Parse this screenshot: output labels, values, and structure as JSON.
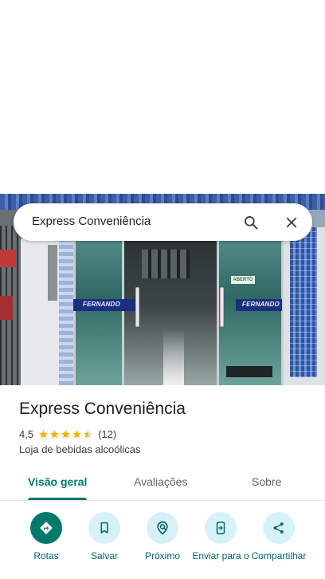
{
  "search": {
    "query": "Express Conveniência",
    "search_icon": "search-icon",
    "close_icon": "close-icon"
  },
  "photo": {
    "brand_text_left": "FERNANDO",
    "brand_text_right": "FERNANDO",
    "door_sign": "ABERTO"
  },
  "place": {
    "title": "Express Conveniência",
    "rating": "4,5",
    "rating_value": 4.5,
    "stars_max": 5,
    "review_count": "(12)",
    "category": "Loja de bebidas alcoólicas"
  },
  "tabs": [
    {
      "label": "Visão geral",
      "active": true
    },
    {
      "label": "Avaliações",
      "active": false
    },
    {
      "label": "Sobre",
      "active": false
    }
  ],
  "actions": [
    {
      "label": "Rotas",
      "icon": "directions-icon"
    },
    {
      "label": "Salvar",
      "icon": "bookmark-icon"
    },
    {
      "label": "Próximo",
      "icon": "nearby-icon"
    },
    {
      "label": "Enviar para o",
      "icon": "send-to-phone-icon"
    },
    {
      "label": "Compartilhar",
      "icon": "share-icon"
    }
  ],
  "colors": {
    "accent": "#00796b",
    "action_bg": "#d7f2f7",
    "star": "#f4b400"
  }
}
